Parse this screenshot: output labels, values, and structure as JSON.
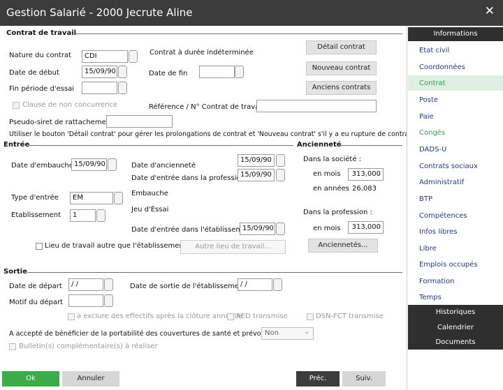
{
  "window": {
    "title": "Gestion Salarié - 2000 Jecrute Aline",
    "close_glyph": "✕"
  },
  "contrat": {
    "section_title": "Contrat de travail",
    "nature_label": "Nature du contrat",
    "nature_value": "CDI",
    "nature_desc": "Contrat à durée indéterminée",
    "date_debut_label": "Date de début",
    "date_debut_value": "15/09/90",
    "date_fin_label": "Date de fin",
    "date_fin_value": "",
    "fin_essai_label": "Fin période d'essai",
    "fin_essai_value": "",
    "clause_label": "Clause de non concurrence",
    "reference_label": "Référence / N° Contrat de travail",
    "reference_value": "",
    "pseudo_siret_label": "Pseudo-siret de rattachement",
    "pseudo_siret_value": "",
    "btn_detail": "Détail contrat",
    "btn_nouveau": "Nouveau contrat",
    "btn_anciens": "Anciens contrats",
    "hint": "Utiliser le bouton 'Détail contrat' pour gérer les prolongations de contrat et 'Nouveau contrat' s'il y a eu rupture de contrat."
  },
  "entree": {
    "section_title": "Entrée",
    "date_embauche_label": "Date d'embauche",
    "date_embauche_value": "15/09/90",
    "date_anciennete_label": "Date d'ancienneté",
    "date_anciennete_value": "15/09/90",
    "date_profession_label": "Date d'entrée dans la profession",
    "date_profession_value": "15/09/90",
    "type_label": "Type d'entrée",
    "type_value": "EM",
    "type_desc": "Embauche",
    "etab_label": "Etablissement",
    "etab_value": "1",
    "etab_desc": "Jeu d'Essai",
    "date_etab_label": "Date d'entrée dans l'établissement",
    "date_etab_value": "15/09/90",
    "lieu_label": "Lieu de travail autre que l'établissement",
    "btn_autre_lieu": "Autre lieu de travail..."
  },
  "anciennete": {
    "section_title": "Ancienneté",
    "societe_label": "Dans la société :",
    "mois_label": "en mois",
    "societe_mois": "313,000",
    "annees_label": "en années",
    "societe_annees": "26,083",
    "profession_label": "Dans la profession :",
    "profession_mois": "313,000",
    "btn_anciennetes": "Anciennetés..."
  },
  "sortie": {
    "section_title": "Sortie",
    "date_depart_label": "Date de départ",
    "date_depart_value": " / /",
    "date_sortie_label": "Date de sortie de l'établissement",
    "date_sortie_value": " / /",
    "motif_label": "Motif du départ",
    "motif_value": "",
    "exclure_label": "à exclure des effectifs après la clôture annuelle",
    "aed_label": "AED transmise",
    "dsn_label": "DSN-FCT transmise",
    "portabilite_label": "A accepté de bénéficier de la portabilité des couvertures de santé et prévoyance",
    "portabilite_value": "Non",
    "bulletin_label": "Bulletin(s) complémentaire(s) à réaliser"
  },
  "footer": {
    "ok": "Ok",
    "annuler": "Annuler",
    "prec": "Préc.",
    "suiv": "Suiv."
  },
  "sidebar": {
    "header": "Informations",
    "items": [
      "Etat civil",
      "Coordonnées",
      "Contrat",
      "Poste",
      "Paie",
      "Congés",
      "DADS-U",
      "Contrats sociaux",
      "Administratif",
      "BTP",
      "Compétences",
      "Infos libres",
      "Libre",
      "Emplois occupés",
      "Formation",
      "Temps"
    ],
    "bottom": [
      "Historiques",
      "Calendrier",
      "Documents"
    ]
  },
  "colors": {
    "titlebar": "#3c3c3c",
    "ok_button": "#3cab4a",
    "nav_link": "#1f3b8f",
    "nav_active": "#3a9c4d",
    "dark_panel": "#2f2f2f"
  }
}
